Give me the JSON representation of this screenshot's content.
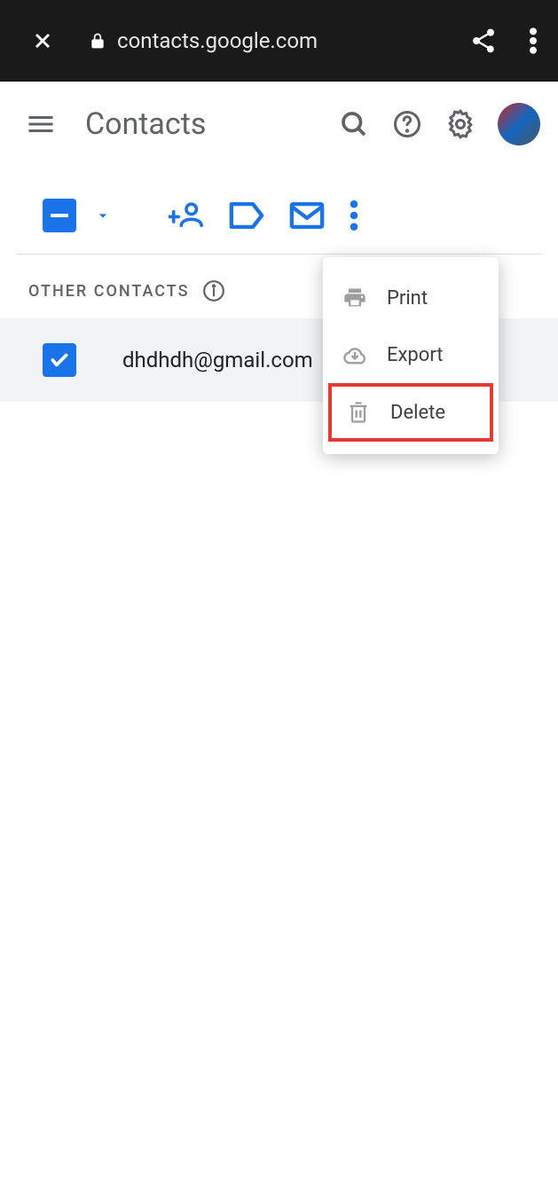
{
  "browser": {
    "url": "contacts.google.com"
  },
  "header": {
    "title": "Contacts"
  },
  "section": {
    "title": "OTHER CONTACTS"
  },
  "contacts": [
    {
      "email": "dhdhdh@gmail.com",
      "selected": true
    }
  ],
  "menu": {
    "items": [
      {
        "label": "Print",
        "icon": "print"
      },
      {
        "label": "Export",
        "icon": "cloud-download"
      },
      {
        "label": "Delete",
        "icon": "trash",
        "highlighted": true
      }
    ]
  }
}
